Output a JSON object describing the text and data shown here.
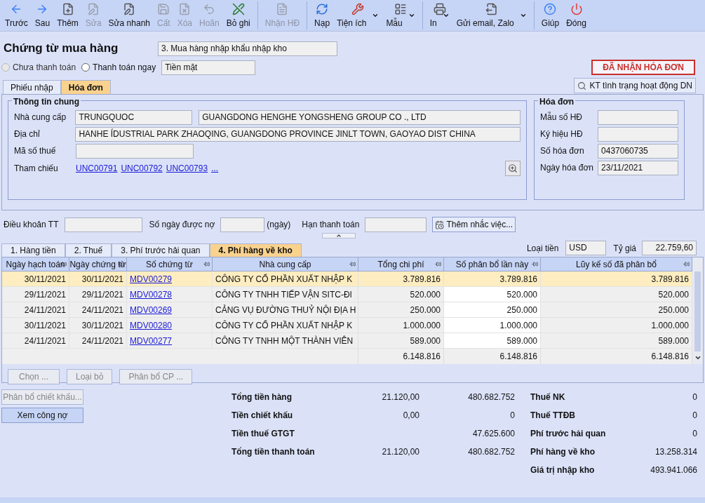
{
  "toolbar": [
    {
      "label": "Trước",
      "disabled": false,
      "dropdown": false,
      "separator": false
    },
    {
      "label": "Sau",
      "disabled": false,
      "dropdown": false,
      "separator": false
    },
    {
      "label": "Thêm",
      "disabled": false,
      "dropdown": false,
      "separator": false
    },
    {
      "label": "Sửa",
      "disabled": true,
      "dropdown": false,
      "separator": false
    },
    {
      "label": "Sửa nhanh",
      "disabled": false,
      "dropdown": false,
      "separator": false
    },
    {
      "label": "Cất",
      "disabled": true,
      "dropdown": false,
      "separator": false
    },
    {
      "label": "Xóa",
      "disabled": true,
      "dropdown": false,
      "separator": false
    },
    {
      "label": "Hoãn",
      "disabled": true,
      "dropdown": false,
      "separator": false
    },
    {
      "label": "Bỏ ghi",
      "disabled": false,
      "dropdown": false,
      "separator": false
    },
    {
      "label": "Nhận HĐ",
      "disabled": true,
      "dropdown": false,
      "separator": true
    },
    {
      "label": "Nạp",
      "disabled": false,
      "dropdown": false,
      "separator": true
    },
    {
      "label": "Tiện ích",
      "disabled": false,
      "dropdown": true,
      "separator": false
    },
    {
      "label": "Mẫu",
      "disabled": false,
      "dropdown": true,
      "separator": false
    },
    {
      "label": "In",
      "disabled": false,
      "dropdown": true,
      "separator": true
    },
    {
      "label": "Gửi email, Zalo",
      "disabled": false,
      "dropdown": true,
      "separator": false
    },
    {
      "label": "Giúp",
      "disabled": false,
      "dropdown": false,
      "separator": true
    },
    {
      "label": "Đóng",
      "disabled": false,
      "dropdown": false,
      "separator": false
    }
  ],
  "title": "Chứng từ mua hàng",
  "voucher_type": "3. Mua hàng nhập khẩu nhập kho",
  "payment_options": [
    {
      "label": "Chưa thanh toán",
      "selected": false,
      "disabled": true
    },
    {
      "label": "Thanh toán ngay",
      "selected": false,
      "disabled": false
    }
  ],
  "payment_method": "Tiền mặt",
  "status_badge": "ĐÃ NHẬN HÓA ĐƠN",
  "top_tabs": [
    {
      "label": "Phiếu nhập",
      "selected": false
    },
    {
      "label": "Hóa đơn",
      "selected": true
    }
  ],
  "check_status_button": "KT tình trạng hoạt động DN",
  "general": {
    "title": "Thông tin chung",
    "supplier_label": "Nhà cung cấp",
    "supplier_code": "TRUNGQUOC",
    "supplier_name": "GUANGDONG HENGHE YONGSHENG GROUP CO ., LTD",
    "address_label": "Địa chỉ",
    "address": "HANHE ÍDUSTRIAL PARK ZHAOQING, GUANGDONG PROVINCE JINLT TOWN, GAOYAO DIST CHINA",
    "tax_label": "Mã số thuế",
    "reference_label": "Tham chiếu",
    "references": [
      "UNC00791",
      "UNC00792",
      "UNC00793",
      "..."
    ]
  },
  "invoice": {
    "title": "Hóa đơn",
    "fields": [
      {
        "label": "Mẫu số HĐ"
      },
      {
        "label": "Ký hiệu HĐ"
      },
      {
        "label": "Số hóa đơn",
        "value": "0437060735"
      },
      {
        "label": "Ngày hóa đơn",
        "value": "23/11/2021"
      }
    ]
  },
  "terms": {
    "payment_terms_label": "Điều khoản TT",
    "credit_days_label": "Số ngày được nợ",
    "days_unit": "(ngày)",
    "due_date_label": "Hạn thanh toán",
    "reminder_button": "Thêm nhắc việc..."
  },
  "detail_tabs": [
    {
      "label": "1. Hàng tiền",
      "selected": false
    },
    {
      "label": "2. Thuế",
      "selected": false
    },
    {
      "label": "3. Phí trước hải quan",
      "selected": false
    },
    {
      "label": "4. Phí hàng về kho",
      "selected": true
    }
  ],
  "currency_label": "Loại tiền",
  "currency": "USD",
  "rate_label": "Tỷ giá",
  "rate": "22.759,60",
  "table": {
    "columns": [
      "Ngày hạch toán",
      "Ngày chứng từ",
      "Số chứng từ",
      "Nhà cung cấp",
      "Tổng chi phí",
      "Số phân bổ lần này",
      "Lũy kế số đã phân bổ"
    ],
    "rows": [
      {
        "selected": true,
        "cells": [
          "30/11/2021",
          "30/11/2021",
          "MDV00279",
          "CÔNG TY CỔ PHẦN XUẤT NHẬP K",
          "3.789.816",
          "3.789.816",
          "3.789.816"
        ]
      },
      {
        "selected": false,
        "cells": [
          "29/11/2021",
          "29/11/2021",
          "MDV00278",
          "CÔNG TY TNHH TIẾP VẬN SITC-ĐI",
          "520.000",
          "520.000",
          "520.000"
        ]
      },
      {
        "selected": false,
        "cells": [
          "24/11/2021",
          "24/11/2021",
          "MDV00269",
          "CẢNG VỤ ĐƯỜNG THUỶ NỘI ĐỊA H",
          "250.000",
          "250.000",
          "250.000"
        ]
      },
      {
        "selected": false,
        "cells": [
          "30/11/2021",
          "30/11/2021",
          "MDV00280",
          "CÔNG TY CỔ PHẦN XUẤT NHẬP K",
          "1.000.000",
          "1.000.000",
          "1.000.000"
        ]
      },
      {
        "selected": false,
        "cells": [
          "24/11/2021",
          "24/11/2021",
          "MDV00277",
          "CÔNG TY TNHH MỘT THÀNH VIÊN",
          "589.000",
          "589.000",
          "589.000"
        ]
      }
    ],
    "totals": [
      "6.148.816",
      "6.148.816",
      "6.148.816"
    ]
  },
  "grid_buttons": [
    "Chọn ...",
    "Loại bỏ",
    "Phân bổ CP ..."
  ],
  "side_buttons": [
    {
      "label": "Phân bổ chiết khấu...",
      "disabled": true
    },
    {
      "label": "Xem công nợ",
      "disabled": false
    }
  ],
  "summary": [
    {
      "label": "Tổng tiền hàng",
      "foreign": "21.120,00",
      "amount": "480.682.752"
    },
    {
      "label": "Tiền chiết khấu",
      "foreign": "0,00",
      "amount": "0"
    },
    {
      "label": "Tiền thuế GTGT",
      "amount": "47.625.600"
    },
    {
      "label": "Tổng tiền thanh toán",
      "foreign": "21.120,00",
      "amount": "480.682.752"
    }
  ],
  "costs": [
    {
      "label": "Thuế NK",
      "amount": "0"
    },
    {
      "label": "Thuế TTĐB",
      "amount": "0"
    },
    {
      "label": "Phí trước hải quan",
      "amount": "0"
    },
    {
      "label": "Phí hàng về kho",
      "amount": "13.258.314"
    },
    {
      "label": "Giá trị nhập kho",
      "amount": "493.941.066"
    }
  ]
}
